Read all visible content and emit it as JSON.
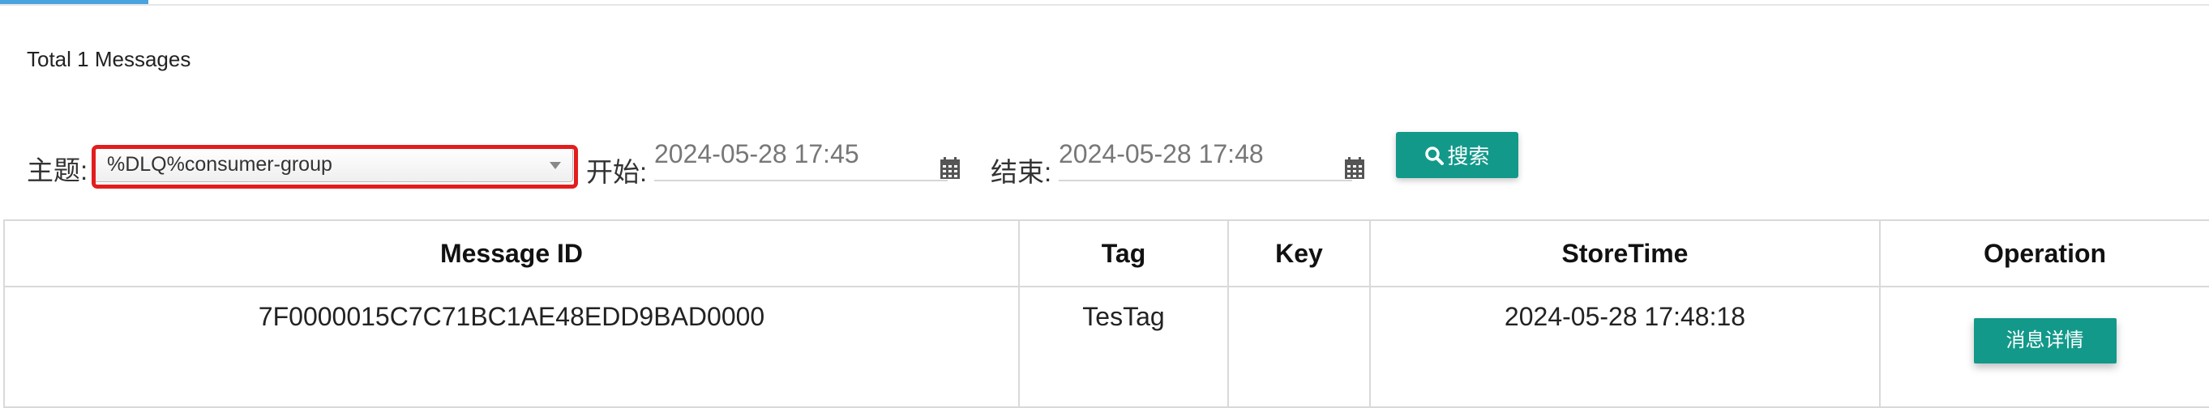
{
  "summary": {
    "total_text": "Total 1 Messages"
  },
  "filters": {
    "topic_label": "主题:",
    "topic_value": "%DLQ%consumer-group",
    "start_label": "开始:",
    "start_value": "2024-05-28 17:45",
    "end_label": "结束:",
    "end_value": "2024-05-28 17:48",
    "calendar_icon": "calendar-icon",
    "search_label": "搜索",
    "search_icon": "search-icon"
  },
  "table": {
    "headers": [
      "Message ID",
      "Tag",
      "Key",
      "StoreTime",
      "Operation"
    ],
    "rows": [
      {
        "message_id": "7F0000015C7C71BC1AE48EDD9BAD0000",
        "tag": "TesTag",
        "key": "",
        "store_time": "2024-05-28 17:48:18",
        "operation_label": "消息详情"
      }
    ]
  },
  "colors": {
    "accent": "#12998a",
    "highlight": "#e31d1d",
    "tab_indicator": "#4aa3df"
  }
}
